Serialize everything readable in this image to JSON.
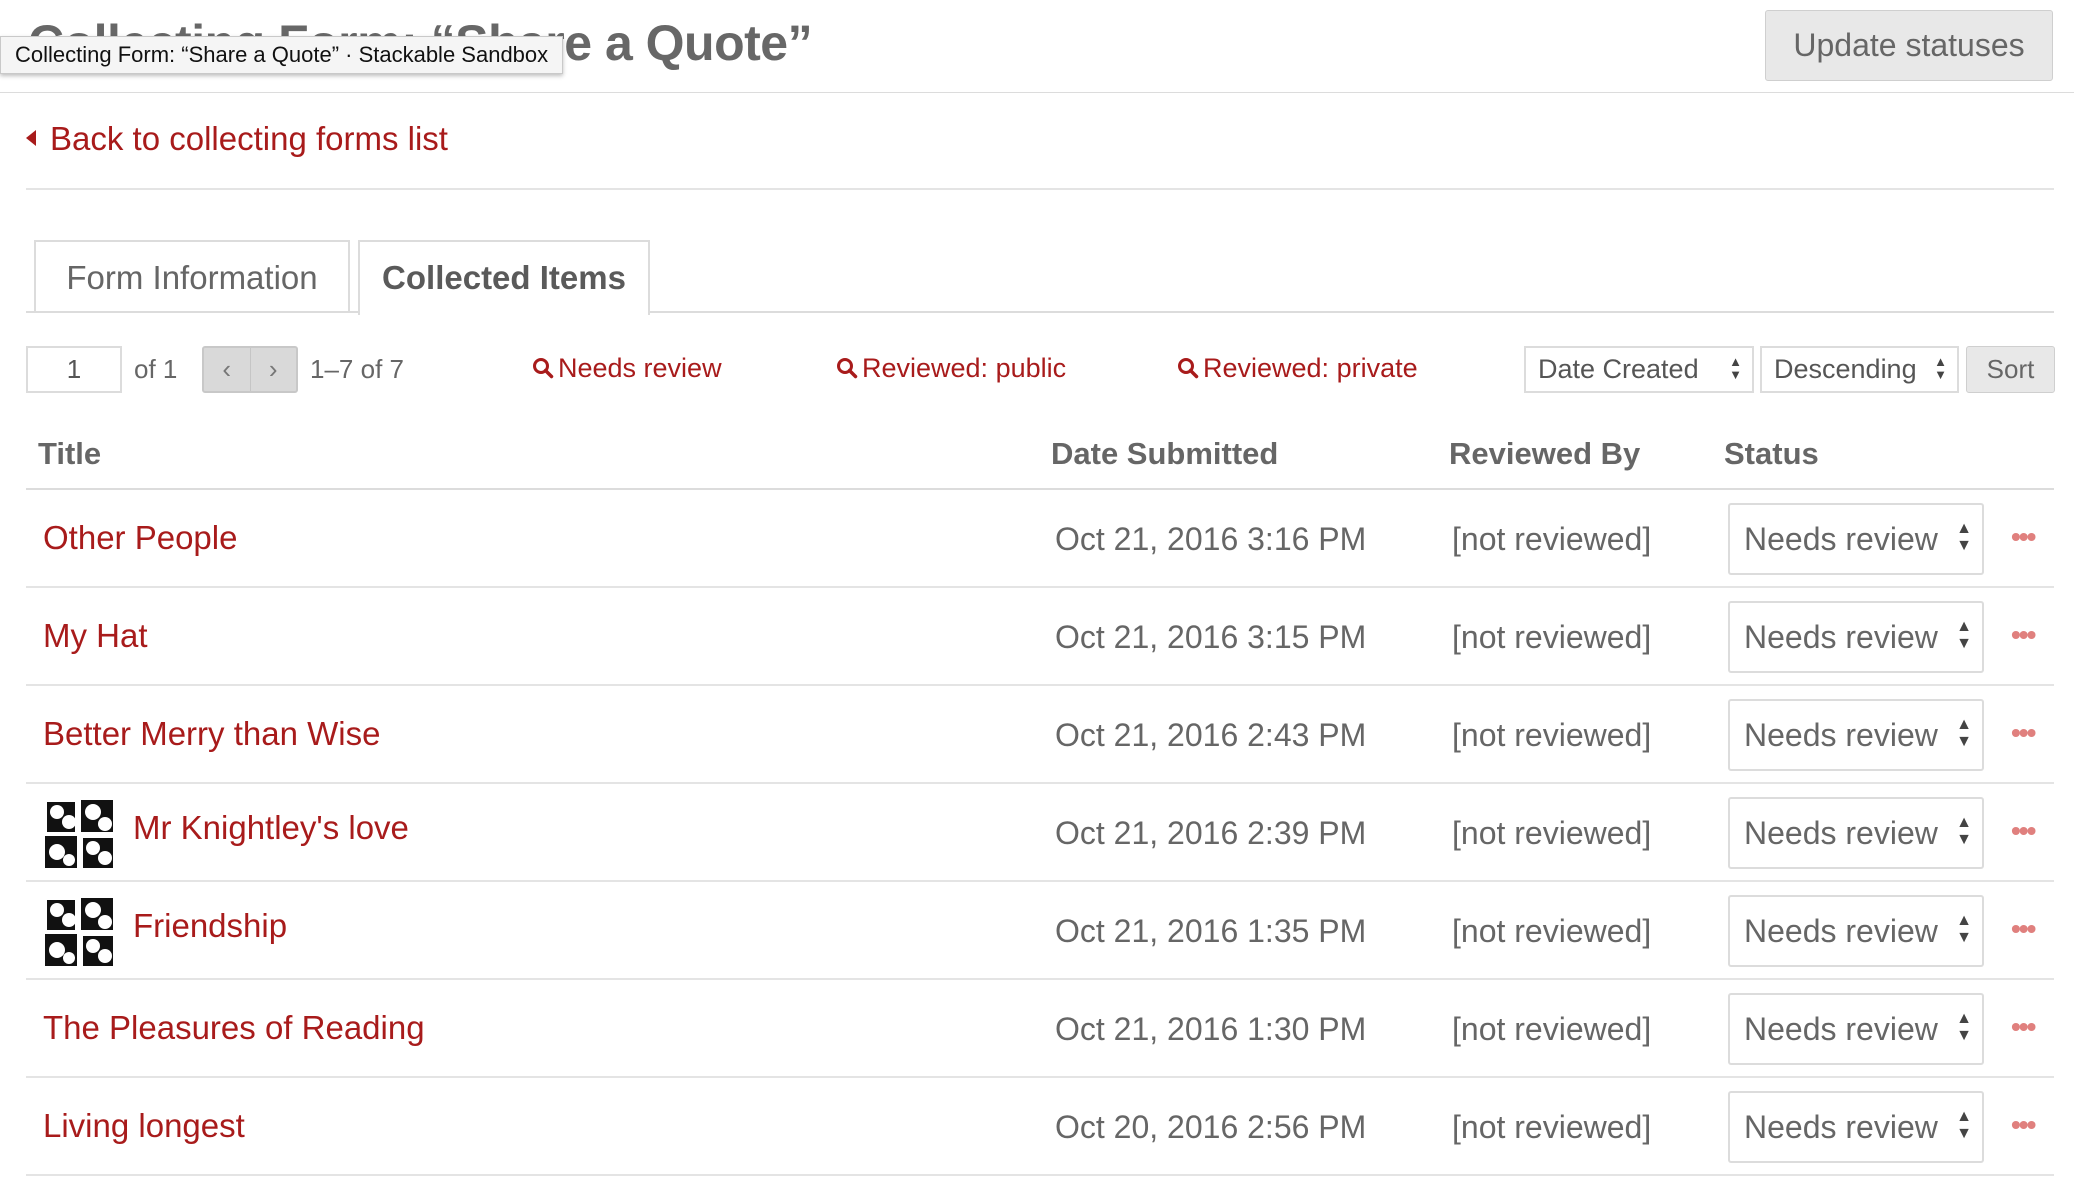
{
  "header": {
    "title": "Collecting Form: “Share a Quote”",
    "tooltip": "Collecting Form: “Share a Quote” · Stackable Sandbox",
    "update_button": "Update statuses"
  },
  "nav": {
    "back_link": "Back to collecting forms list"
  },
  "tabs": [
    {
      "label": "Form Information",
      "active": false
    },
    {
      "label": "Collected Items",
      "active": true
    }
  ],
  "toolbar": {
    "page_value": "1",
    "of_text": "of 1",
    "prev_label": "‹",
    "next_label": "›",
    "range_text": "1–7 of 7",
    "filters": [
      "Needs review",
      "Reviewed: public",
      "Reviewed: private"
    ],
    "sort_field": "Date Created",
    "sort_direction": "Descending",
    "sort_button": "Sort"
  },
  "table": {
    "columns": [
      "Title",
      "Date Submitted",
      "Reviewed By",
      "Status"
    ],
    "rows": [
      {
        "title": "Other People",
        "date": "Oct 21, 2016 3:16 PM",
        "reviewed_by": "[not reviewed]",
        "status": "Needs review",
        "thumb": false
      },
      {
        "title": "My Hat",
        "date": "Oct 21, 2016 3:15 PM",
        "reviewed_by": "[not reviewed]",
        "status": "Needs review",
        "thumb": false
      },
      {
        "title": "Better Merry than Wise",
        "date": "Oct 21, 2016 2:43 PM",
        "reviewed_by": "[not reviewed]",
        "status": "Needs review",
        "thumb": false
      },
      {
        "title": "Mr Knightley's love",
        "date": "Oct 21, 2016 2:39 PM",
        "reviewed_by": "[not reviewed]",
        "status": "Needs review",
        "thumb": true
      },
      {
        "title": "Friendship",
        "date": "Oct 21, 2016 1:35 PM",
        "reviewed_by": "[not reviewed]",
        "status": "Needs review",
        "thumb": true
      },
      {
        "title": "The Pleasures of Reading",
        "date": "Oct 21, 2016 1:30 PM",
        "reviewed_by": "[not reviewed]",
        "status": "Needs review",
        "thumb": false
      },
      {
        "title": "Living longest",
        "date": "Oct 20, 2016 2:56 PM",
        "reviewed_by": "[not reviewed]",
        "status": "Needs review",
        "thumb": false
      }
    ],
    "more_label": "•••"
  },
  "colors": {
    "accent": "#a81b1b",
    "text": "#666666",
    "border": "#dcdcdc",
    "more_dots": "#e0807e"
  },
  "icons": {
    "filter": "search-icon",
    "back": "caret-left-icon",
    "select": "sort-arrows-icon",
    "row_menu": "more-dots-icon",
    "thumbnail": "quote-marks-icon"
  }
}
